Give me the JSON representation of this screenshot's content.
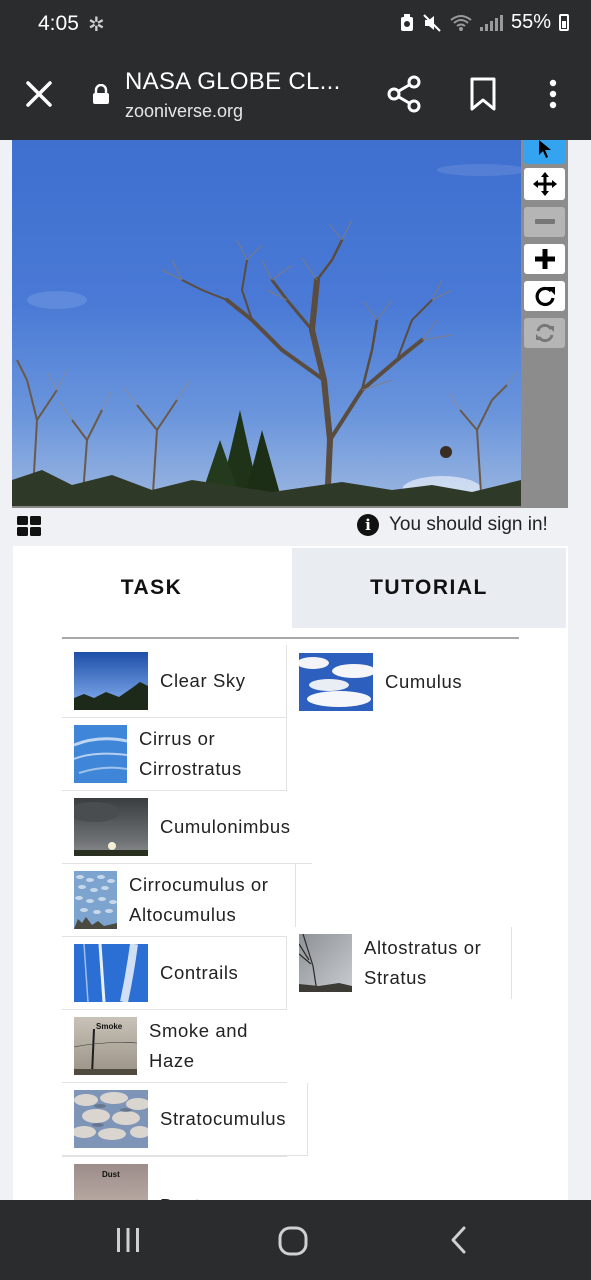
{
  "status_bar": {
    "time": "4:05",
    "battery": "55%"
  },
  "browser": {
    "title": "NASA GLOBE CL...",
    "url": "zooniverse.org"
  },
  "viewer": {
    "sign_in_notice": "You should sign in!"
  },
  "tabs": {
    "task": "TASK",
    "tutorial": "TUTORIAL"
  },
  "choices": [
    {
      "id": "clear-sky",
      "label_lines": [
        "Clear Sky"
      ]
    },
    {
      "id": "cumulus",
      "label_lines": [
        "Cumulus"
      ]
    },
    {
      "id": "cirrus",
      "label_lines": [
        "Cirrus or",
        "Cirrostratus"
      ]
    },
    {
      "id": "cumulonimbus",
      "label_lines": [
        "Cumulonimbus"
      ]
    },
    {
      "id": "cirrocumulus",
      "label_lines": [
        "Cirrocumulus or",
        "Altocumulus"
      ]
    },
    {
      "id": "contrails",
      "label_lines": [
        "Contrails"
      ]
    },
    {
      "id": "altostratus",
      "label_lines": [
        "Altostratus or",
        "Stratus"
      ]
    },
    {
      "id": "smoke",
      "label_lines": [
        "Smoke and",
        "Haze"
      ],
      "thumb_text": "Smoke"
    },
    {
      "id": "stratocumulus",
      "label_lines": [
        "Stratocumulus"
      ]
    },
    {
      "id": "dust",
      "label_lines": [
        "Dust"
      ],
      "thumb_text": "Dust"
    }
  ],
  "colors": {
    "system_bar": "#2b2c2e",
    "page_background": "#eff1f4",
    "active_tool": "#34a4f1",
    "toolbar": "#8c8c8c"
  }
}
